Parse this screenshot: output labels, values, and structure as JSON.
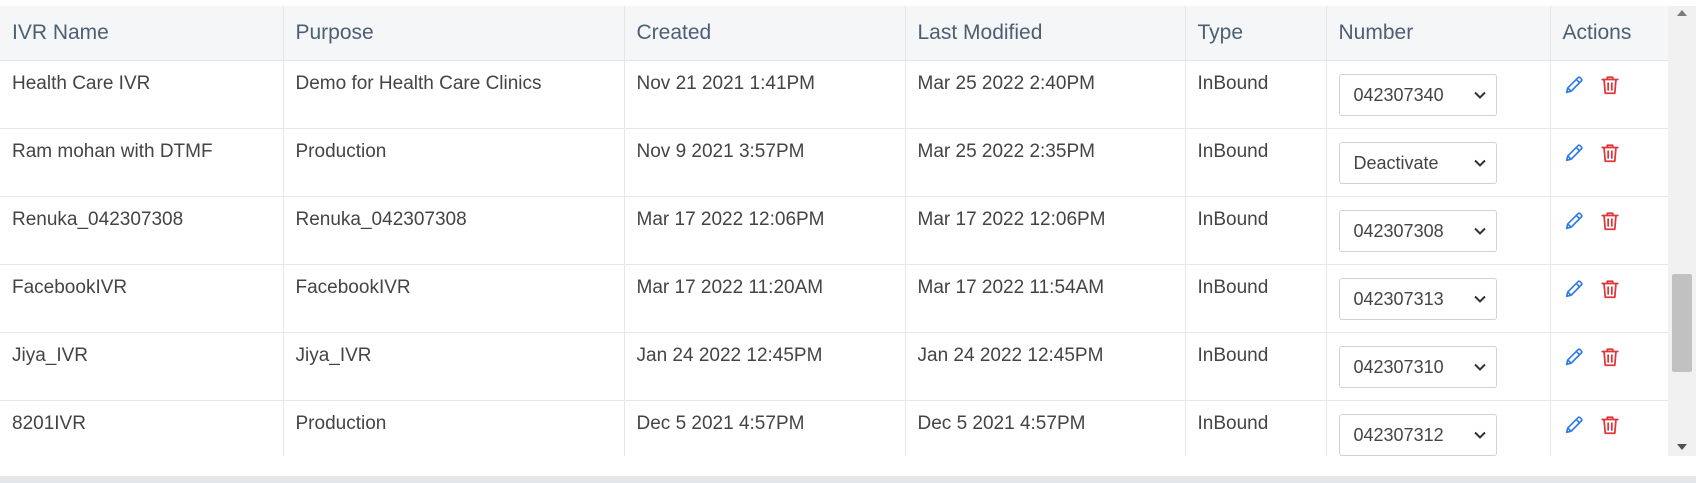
{
  "table": {
    "headers": [
      "IVR Name",
      "Purpose",
      "Created",
      "Last Modified",
      "Type",
      "Number",
      "Actions"
    ],
    "rows": [
      {
        "name": "Health Care IVR",
        "purpose": "Demo for Health Care Clinics",
        "created": "Nov 21 2021 1:41PM",
        "modified": "Mar 25 2022 2:40PM",
        "type": "InBound",
        "number": "042307340"
      },
      {
        "name": "Ram mohan with DTMF",
        "purpose": "Production",
        "created": "Nov 9 2021 3:57PM",
        "modified": "Mar 25 2022 2:35PM",
        "type": "InBound",
        "number": "Deactivate"
      },
      {
        "name": "Renuka_042307308",
        "purpose": "Renuka_042307308",
        "created": "Mar 17 2022 12:06PM",
        "modified": "Mar 17 2022 12:06PM",
        "type": "InBound",
        "number": "042307308"
      },
      {
        "name": "FacebookIVR",
        "purpose": "FacebookIVR",
        "created": "Mar 17 2022 11:20AM",
        "modified": "Mar 17 2022 11:54AM",
        "type": "InBound",
        "number": "042307313"
      },
      {
        "name": "Jiya_IVR",
        "purpose": "Jiya_IVR",
        "created": "Jan 24 2022 12:45PM",
        "modified": "Jan 24 2022 12:45PM",
        "type": "InBound",
        "number": "042307310"
      },
      {
        "name": "8201IVR",
        "purpose": "Production",
        "created": "Dec 5 2021 4:57PM",
        "modified": "Dec 5 2021 4:57PM",
        "type": "InBound",
        "number": "042307312"
      }
    ]
  },
  "icons": {
    "edit": "pencil-icon",
    "delete": "trash-icon",
    "dropdown": "chevron-down-icon"
  },
  "colors": {
    "edit": "#2f7de1",
    "delete": "#e0363a",
    "header_text": "#4d5f74",
    "header_bg": "#f5f6f7"
  }
}
